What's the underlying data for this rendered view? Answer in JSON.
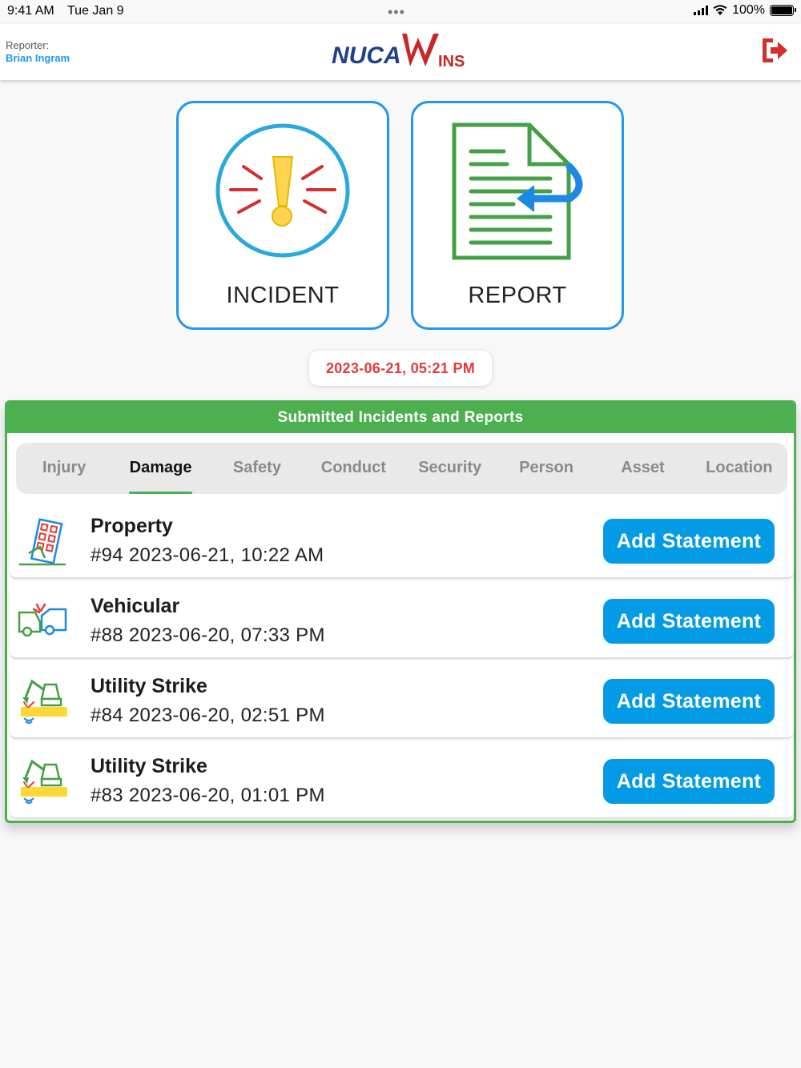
{
  "status_bar": {
    "time": "9:41 AM",
    "date": "Tue Jan 9",
    "battery": "100%"
  },
  "header": {
    "reporter_label": "Reporter:",
    "reporter_name": "Brian Ingram",
    "logo_text": "NUCAWINS"
  },
  "tiles": {
    "incident_label": "INCIDENT",
    "report_label": "REPORT"
  },
  "timestamp": "2023-06-21, 05:21 PM",
  "panel": {
    "title": "Submitted Incidents and Reports",
    "tabs": [
      "Injury",
      "Damage",
      "Safety",
      "Conduct",
      "Security",
      "Person",
      "Asset",
      "Location"
    ],
    "active_tab": "Damage",
    "items": [
      {
        "title": "Property",
        "meta": "#94 2023-06-21, 10:22 AM",
        "button": "Add Statement",
        "icon": "property-damage-icon"
      },
      {
        "title": "Vehicular",
        "meta": "#88 2023-06-20, 07:33 PM",
        "button": "Add Statement",
        "icon": "vehicle-collision-icon"
      },
      {
        "title": "Utility Strike",
        "meta": "#84 2023-06-20, 02:51 PM",
        "button": "Add Statement",
        "icon": "excavator-strike-icon"
      },
      {
        "title": "Utility Strike",
        "meta": "#83 2023-06-20, 01:01 PM",
        "button": "Add Statement",
        "icon": "excavator-strike-icon"
      }
    ]
  },
  "colors": {
    "accent_blue": "#2196f3",
    "button_blue": "#039be5",
    "green": "#4caf50",
    "red": "#e53935",
    "logo_navy": "#1f3f8f",
    "logo_red": "#c62828"
  }
}
